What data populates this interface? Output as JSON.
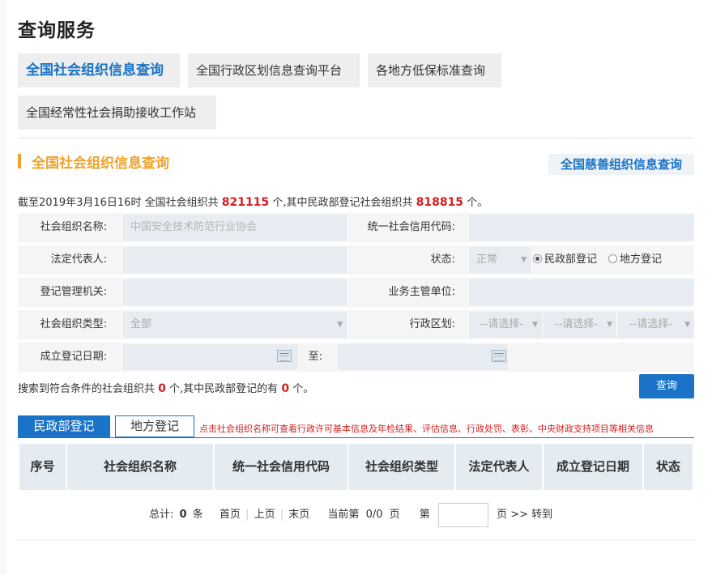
{
  "page_title": "查询服务",
  "tabs": [
    {
      "label": "全国社会组织信息查询",
      "active": true
    },
    {
      "label": "全国行政区划信息查询平台",
      "active": false
    },
    {
      "label": "各地方低保标准查询",
      "active": false
    },
    {
      "label": "全国经常性社会捐助接收工作站",
      "active": false
    }
  ],
  "section": {
    "title": "全国社会组织信息查询",
    "charity_link": "全国慈善组织信息查询"
  },
  "stats": {
    "prefix": "截至2019年3月16日16时 全国社会组织共",
    "total": "821115",
    "mid": "个,其中民政部登记社会组织共",
    "ministry": "818815",
    "suffix": "个。"
  },
  "form": {
    "org_name_label": "社会组织名称:",
    "org_name_placeholder": "中国安全技术防范行业协会",
    "credit_code_label": "统一社会信用代码:",
    "legal_rep_label": "法定代表人:",
    "status_label": "状态:",
    "status_value": "正常",
    "radio_ministry": "民政部登记",
    "radio_local": "地方登记",
    "reg_authority_label": "登记管理机关:",
    "business_unit_label": "业务主管单位:",
    "org_type_label": "社会组织类型:",
    "org_type_value": "全部",
    "region_label": "行政区划:",
    "region_select_1": "--请选择-",
    "region_select_2": "--请选择-",
    "region_select_3": "--请选择-",
    "date_label": "成立登记日期:",
    "date_to_label": "至:"
  },
  "result": {
    "prefix": "搜索到符合条件的社会组织共",
    "count": "0",
    "mid": "个,其中民政部登记的有",
    "ministry_count": "0",
    "suffix": "个。"
  },
  "search_button": "查询",
  "sub_tabs": [
    "民政部登记",
    "地方登记"
  ],
  "hint": "点击社会组织名称可查看行政许可基本信息及年检结果、评估信息、行政处罚、表彰、中央财政支持项目等相关信息",
  "table_headers": [
    "序号",
    "社会组织名称",
    "统一社会信用代码",
    "社会组织类型",
    "法定代表人",
    "成立登记日期",
    "状态"
  ],
  "pager": {
    "total_label": "总计:",
    "total_count": "0",
    "total_unit": "条",
    "first": "首页",
    "prev": "上页",
    "last": "末页",
    "current_label": "当前第",
    "current_value": "0/0",
    "current_unit": "页",
    "goto_prefix": "第",
    "goto_suffix": "页 >> 转到"
  }
}
